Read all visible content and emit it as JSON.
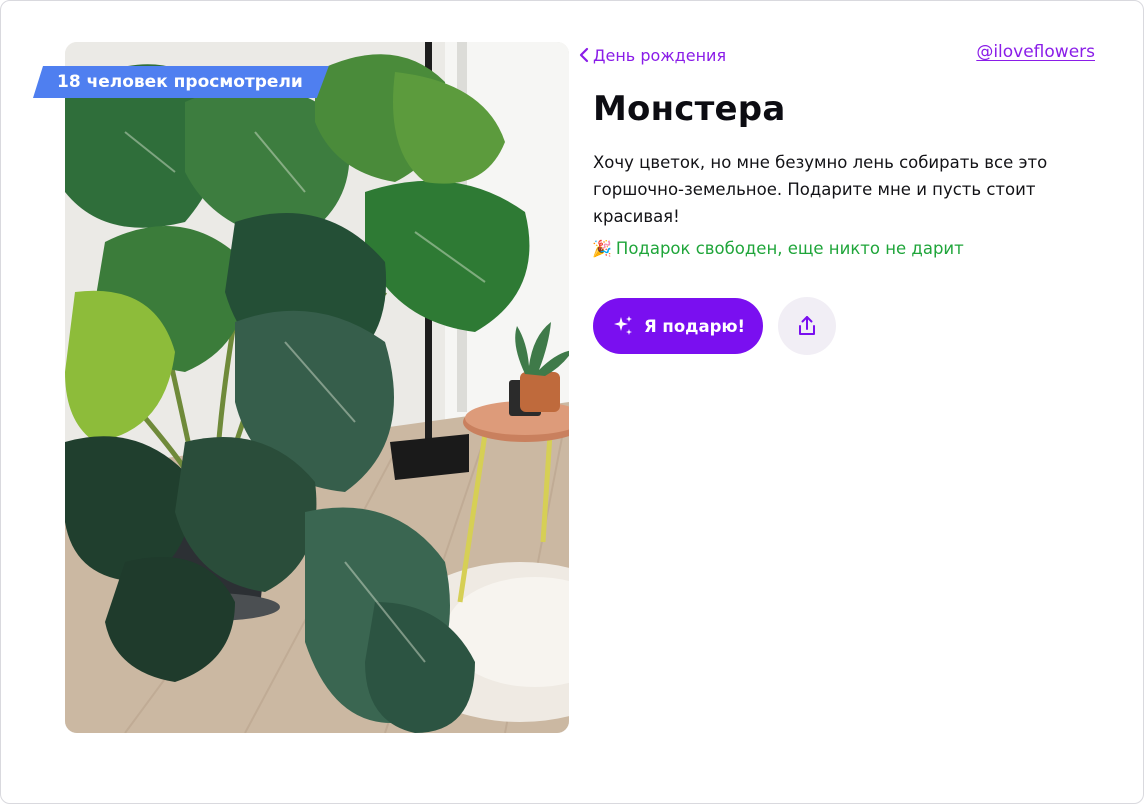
{
  "badge": {
    "views_text": "18 человек просмотрели"
  },
  "nav": {
    "back_label": "День рождения",
    "username": "@iloveflowers"
  },
  "gift": {
    "title": "Монстера",
    "description": "Хочу цветок, но мне безумно лень собирать все это горшочно-земельное. Подарите мне и пусть стоит красивая!",
    "status_text": "Подарок свободен, еще никто не дарит"
  },
  "actions": {
    "gift_button_label": "Я подарю!"
  },
  "icons": {
    "back": "chevron-left-icon",
    "status": "party-popper-icon",
    "gift_button": "sparkles-icon",
    "share": "share-icon"
  },
  "colors": {
    "accent": "#7a0ff0",
    "link": "#8a1de8",
    "badge": "#4f7ff0",
    "status_free": "#1fa53a",
    "share_bg": "#f1eef5"
  }
}
